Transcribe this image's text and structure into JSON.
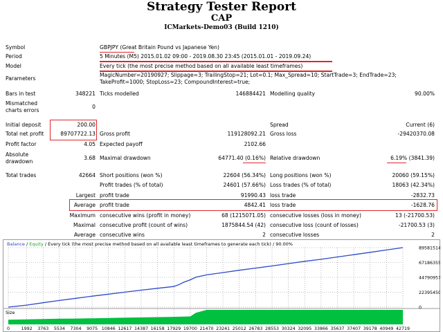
{
  "header": {
    "title": "Strategy Tester Report",
    "expert": "CAP",
    "server": "ICMarkets-Demo03 (Build 1210)"
  },
  "info": {
    "symbol_label": "Symbol",
    "symbol_value": "GBPJPY (Great Britain Pound vs Japanese Yen)",
    "period_label": "Period",
    "period_value": "5 Minutes (M5) 2015.01.02 09:00 - 2019.08.30 23:45 (2015.01.01 - 2019.09.24)",
    "model_label": "Model",
    "model_value": "Every tick (the most precise method based on all available least timeframes)",
    "params_label": "Parameters",
    "params_line1": "MagicNumber=20190927; Slippage=3; TrailingStop=21; Lot=0.1; Max_Spread=10; StartTrade=3; EndTrade=23;",
    "params_line2": "TakeProfit=1000; StopLoss=23; CompoundInterest=true;"
  },
  "stats": {
    "bars_label": "Bars in test",
    "bars_value": "348221",
    "ticks_label": "Ticks modelled",
    "ticks_value": "146884421",
    "quality_label": "Modelling quality",
    "quality_value": "90.00%",
    "mismatch_label1": "Mismatched",
    "mismatch_label2": "charts errors",
    "mismatch_value": "0",
    "deposit_label": "Initial deposit",
    "deposit_value": "200.00",
    "spread_label": "Spread",
    "spread_value": "Current (6)",
    "netprofit_label": "Total net profit",
    "netprofit_value": "89707722.13",
    "grossprofit_label": "Gross profit",
    "grossprofit_value": "119128092.21",
    "grossloss_label": "Gross loss",
    "grossloss_value": "-29420370.08",
    "pf_label": "Profit factor",
    "pf_value": "4.05",
    "payoff_label": "Expected payoff",
    "payoff_value": "2102.66",
    "absdd_label1": "Absolute",
    "absdd_label2": "drawdown",
    "absdd_value": "3.68",
    "maxdd_label": "Maximal drawdown",
    "maxdd_value": "64771.40 (0.16%)",
    "reldd_label": "Relative drawdown",
    "reldd_value": "6.19% (3841.39)",
    "trades_label": "Total trades",
    "trades_value": "42664",
    "short_label": "Short positions (won %)",
    "short_value": "22604 (56.34%)",
    "long_label": "Long positions (won %)",
    "long_value": "20060 (59.15%)",
    "ptrades_label": "Profit trades (% of total)",
    "ptrades_value": "24601 (57.66%)",
    "ltrades_label": "Loss trades (% of total)",
    "ltrades_value": "18063 (42.34%)",
    "largest_label": "Largest",
    "largest_pt_label": "profit trade",
    "largest_pt_value": "91990.43",
    "largest_lt_label": "loss trade",
    "largest_lt_value": "-2832.73",
    "avg_label": "Average",
    "avg_pt_label": "profit trade",
    "avg_pt_value": "4842.41",
    "avg_lt_label": "loss trade",
    "avg_lt_value": "-1628.76",
    "max_label": "Maximum",
    "max_cw_label": "consecutive wins (profit in money)",
    "max_cw_value": "68 (1215071.05)",
    "max_cl_label": "consecutive losses (loss in money)",
    "max_cl_value": "13 (-21700.53)",
    "maxl_label": "Maximal",
    "maxl_cw_label": "consecutive profit (count of wins)",
    "maxl_cw_value": "1875844.54 (42)",
    "maxl_cl_label": "consecutive loss (count of losses)",
    "maxl_cl_value": "-21700.53 (3)",
    "avgc_label": "Average",
    "avgc_cw_label": "consecutive wins",
    "avgc_cw_value": "2",
    "avgc_cl_label": "consecutive losses",
    "avgc_cl_value": "2"
  },
  "chart_data": {
    "type": "line",
    "legend_balance": "Balance",
    "legend_sep": " / ",
    "legend_equity": "Equity",
    "legend_text": " / Every tick (the most precise method based on all available least timeframes to generate each tick) / 90.00%",
    "size_label": "Size",
    "colors": {
      "balance": "#2a48c8",
      "size": "#00c040",
      "grid": "#8a8a8a"
    },
    "y_ticks": [
      "89581514",
      "67186355",
      "44790957",
      "22395450",
      "0"
    ],
    "ylim": [
      0,
      89581514
    ],
    "x_ticks": [
      "0",
      "1992",
      "3763",
      "5534",
      "7304",
      "9075",
      "10846",
      "12617",
      "14387",
      "16158",
      "17929",
      "19700",
      "21470",
      "23241",
      "25012",
      "26783",
      "28553",
      "30324",
      "32095",
      "33866",
      "35637",
      "37407",
      "39178",
      "40949",
      "42719"
    ],
    "xlim": [
      0,
      42719
    ],
    "balance_x": [
      0,
      1992,
      3763,
      5534,
      7304,
      9075,
      10846,
      12617,
      14387,
      16158,
      17929,
      18500,
      19000,
      19700,
      20300,
      21470,
      23241,
      25012,
      26783,
      28553,
      30324,
      32095,
      33866,
      35637,
      37407,
      39178,
      40949,
      42719
    ],
    "balance_y": [
      200,
      3000000,
      6600000,
      10000000,
      13200000,
      16500000,
      19500000,
      22500000,
      25500000,
      28300000,
      31000000,
      34000000,
      37500000,
      41000000,
      45000000,
      48500000,
      52000000,
      55500000,
      58800000,
      62000000,
      65500000,
      69000000,
      72000000,
      75500000,
      79000000,
      82500000,
      86000000,
      89581514
    ],
    "size_x": [
      0,
      1992,
      3763,
      5534,
      7304,
      9075,
      10846,
      12617,
      14387,
      16158,
      17929,
      19700,
      20300,
      21470,
      42719
    ],
    "size_y": [
      0.32,
      0.35,
      0.37,
      0.39,
      0.4,
      0.42,
      0.44,
      0.46,
      0.48,
      0.5,
      0.52,
      0.55,
      0.8,
      1.0,
      1.0
    ]
  }
}
